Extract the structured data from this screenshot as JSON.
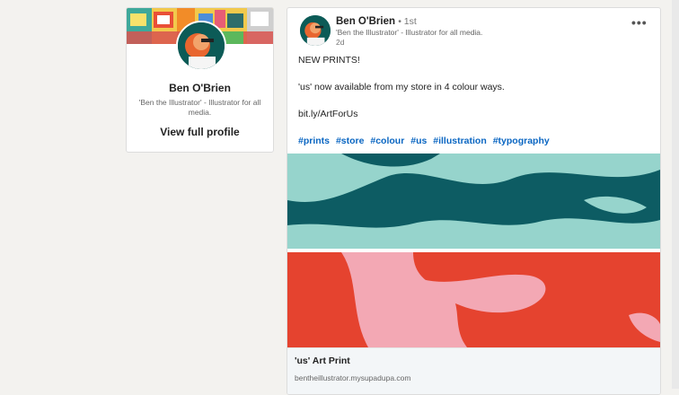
{
  "profile": {
    "name": "Ben O'Brien",
    "headline": "'Ben the Illustrator' - Illustrator for all media.",
    "view_profile_label": "View full profile"
  },
  "post": {
    "author_name": "Ben O'Brien",
    "degree": "• 1st",
    "author_headline": "'Ben the Illustrator' - Illustrator for all media.",
    "time_ago": "2d",
    "more_icon": "•••",
    "lines": [
      "NEW PRINTS!",
      "'us' now available from my store in 4 colour ways.",
      "bit.ly/ArtForUs"
    ],
    "hashtags": [
      "#prints",
      "#store",
      "#colour",
      "#us",
      "#illustration",
      "#typography"
    ],
    "link_title": "'us' Art Print",
    "link_url": "bentheillustrator.mysupadupa.com"
  },
  "colors": {
    "teal_dark": "#0d5c63",
    "teal_light": "#96d4cc",
    "red": "#e5432f",
    "pink": "#f3a8b4",
    "link_blue": "#0a66c2"
  }
}
